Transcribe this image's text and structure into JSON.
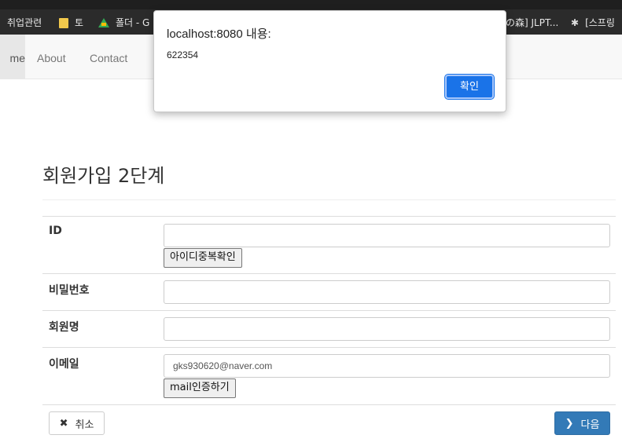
{
  "bookmarks": [
    {
      "label": "취업관련",
      "icon": "none"
    },
    {
      "label": "토",
      "icon": "folder-icon"
    },
    {
      "label": "폴더 - G",
      "icon": "google-drive-icon"
    },
    {
      "label": "の森] JLPT...",
      "icon": "none"
    },
    {
      "label": "[스프링",
      "icon": "github-icon"
    }
  ],
  "nav": {
    "home": "me",
    "about": "About",
    "contact": "Contact"
  },
  "dialog": {
    "title": "localhost:8080 내용:",
    "message": "622354",
    "ok": "확인",
    "accent": "#1a73e8"
  },
  "page": {
    "title": "회원가입 2단계"
  },
  "form": {
    "id_label": "ID",
    "id_value": "",
    "dup_check": "아이디중복확인",
    "pw_label": "비밀번호",
    "pw_value": "",
    "name_label": "회원명",
    "name_value": "",
    "email_label": "이메일",
    "email_value": "gks930620@naver.com",
    "mail_verify": "mail인증하기"
  },
  "actions": {
    "cancel": "취소",
    "cancel_icon": "close-icon",
    "next": "다음",
    "next_icon": "chevron-right-icon",
    "next_color": "#337ab7"
  }
}
